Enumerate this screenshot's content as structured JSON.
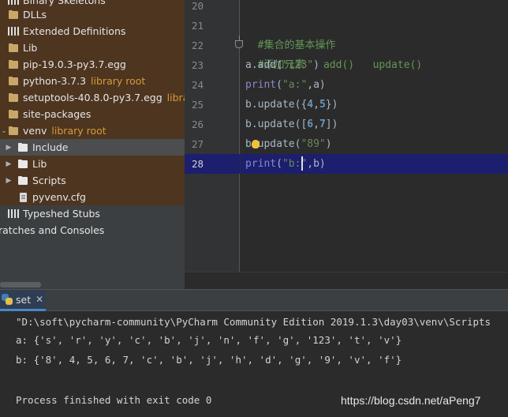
{
  "project_tree": {
    "items": [
      {
        "label": "Binary Skeletons",
        "tag": "",
        "icon": "library-icon"
      },
      {
        "label": "DLLs",
        "tag": "",
        "icon": "folder-icon"
      },
      {
        "label": "Extended Definitions",
        "tag": "",
        "icon": "library-icon"
      },
      {
        "label": "Lib",
        "tag": "",
        "icon": "folder-icon"
      },
      {
        "label": "pip-19.0.3-py3.7.egg",
        "tag": "",
        "icon": "folder-icon"
      },
      {
        "label": "python-3.7.3",
        "tag": "library root",
        "icon": "folder-icon"
      },
      {
        "label": "setuptools-40.8.0-py3.7.egg",
        "tag": "library r",
        "icon": "folder-icon"
      },
      {
        "label": "site-packages",
        "tag": "",
        "icon": "folder-icon"
      },
      {
        "label": "venv",
        "tag": "library root",
        "icon": "folder-icon"
      },
      {
        "label": "Include",
        "tag": "",
        "icon": "folder-icon"
      },
      {
        "label": "Lib",
        "tag": "",
        "icon": "folder-icon"
      },
      {
        "label": "Scripts",
        "tag": "",
        "icon": "folder-icon"
      },
      {
        "label": "pyvenv.cfg",
        "tag": "",
        "icon": "file-icon"
      },
      {
        "label": "Typeshed Stubs",
        "tag": "",
        "icon": "library-icon"
      },
      {
        "label": "ratches and Consoles",
        "tag": "",
        "icon": ""
      }
    ]
  },
  "editor": {
    "line_numbers": [
      "20",
      "21",
      "22",
      "23",
      "24",
      "25",
      "26",
      "27",
      "28"
    ],
    "current_line": "28",
    "lines": {
      "l21": "#集合的基本操作",
      "l22": "#添加元素   add()   update()",
      "l23_a": "a.add(",
      "l23_s": "\"123\"",
      "l23_b": ")",
      "l24_p": "print",
      "l24_a": "(",
      "l24_s": "\"a:\"",
      "l24_b": ",a)",
      "l25_a": "b.update({",
      "l25_n1": "4",
      "l25_c": ",",
      "l25_n2": "5",
      "l25_b": "})",
      "l26_a": "b.update([",
      "l26_n1": "6",
      "l26_c": ",",
      "l26_n2": "7",
      "l26_b": "])",
      "l27_a": "b.update(",
      "l27_s": "\"89\"",
      "l27_b": ")",
      "l28_p": "print",
      "l28_a": "(",
      "l28_s": "\"b:\"",
      "l28_b": ",b)"
    }
  },
  "run_panel": {
    "tab_label": "set",
    "close_glyph": "✕",
    "output": [
      "\"D:\\soft\\pycharm-community\\PyCharm Community Edition 2019.1.3\\day03\\venv\\Scripts",
      "a: {'s', 'r', 'y', 'c', 'b', 'j', 'n', 'f', 'g', '123', 't', 'v'}",
      "b: {'8', 4, 5, 6, 7, 'c', 'b', 'j', 'h', 'd', 'g', '9', 'v', 'f'}",
      "",
      "Process finished with exit code 0"
    ]
  },
  "watermark": "https://blog.csdn.net/aPeng7",
  "colors": {
    "tree_bg": "#3c3f41",
    "tree_highlight": "#4d3520",
    "library_root_tag": "#d79a3a",
    "current_line_bg": "#1c1f6e",
    "comment": "#629755",
    "string": "#6a8759",
    "number": "#6897bb",
    "builtin": "#8888c6"
  }
}
